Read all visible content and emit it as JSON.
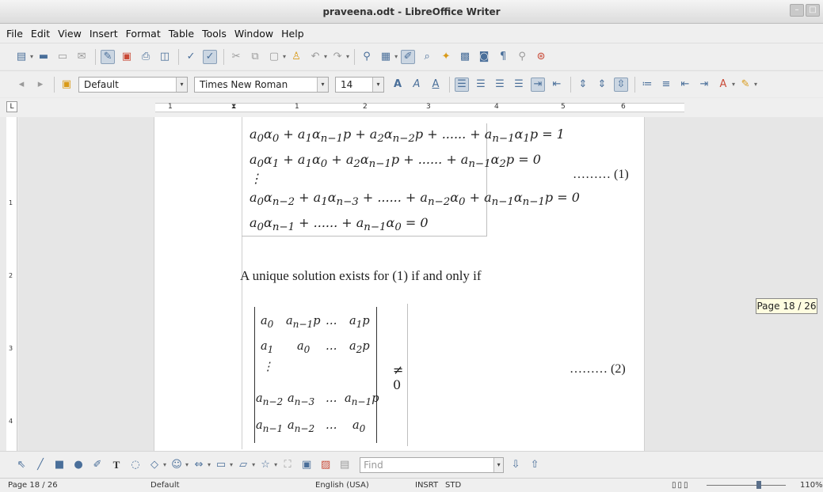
{
  "window": {
    "title": "praveena.odt - LibreOffice Writer"
  },
  "menu": [
    "File",
    "Edit",
    "View",
    "Insert",
    "Format",
    "Table",
    "Tools",
    "Window",
    "Help"
  ],
  "formatting": {
    "paragraph_style": "Default",
    "font_name": "Times New Roman",
    "font_size": "14"
  },
  "ruler": {
    "h_marks": [
      "1",
      "1",
      "2",
      "3",
      "4",
      "5",
      "6"
    ],
    "v_marks": [
      "1",
      "2",
      "3",
      "4"
    ]
  },
  "document": {
    "system_eq_number": "……… (1)",
    "sentence": "A unique solution exists for (1) if and only if",
    "neq": "≠ 0",
    "det_eq_number": "……… (2)"
  },
  "page_badge": "Page 18 / 26",
  "find": {
    "placeholder": "Find"
  },
  "status": {
    "page": "Page 18 / 26",
    "style": "Default",
    "language": "English (USA)",
    "insert_mode": "INSRT",
    "selection_mode": "STD",
    "zoom": "110%"
  }
}
